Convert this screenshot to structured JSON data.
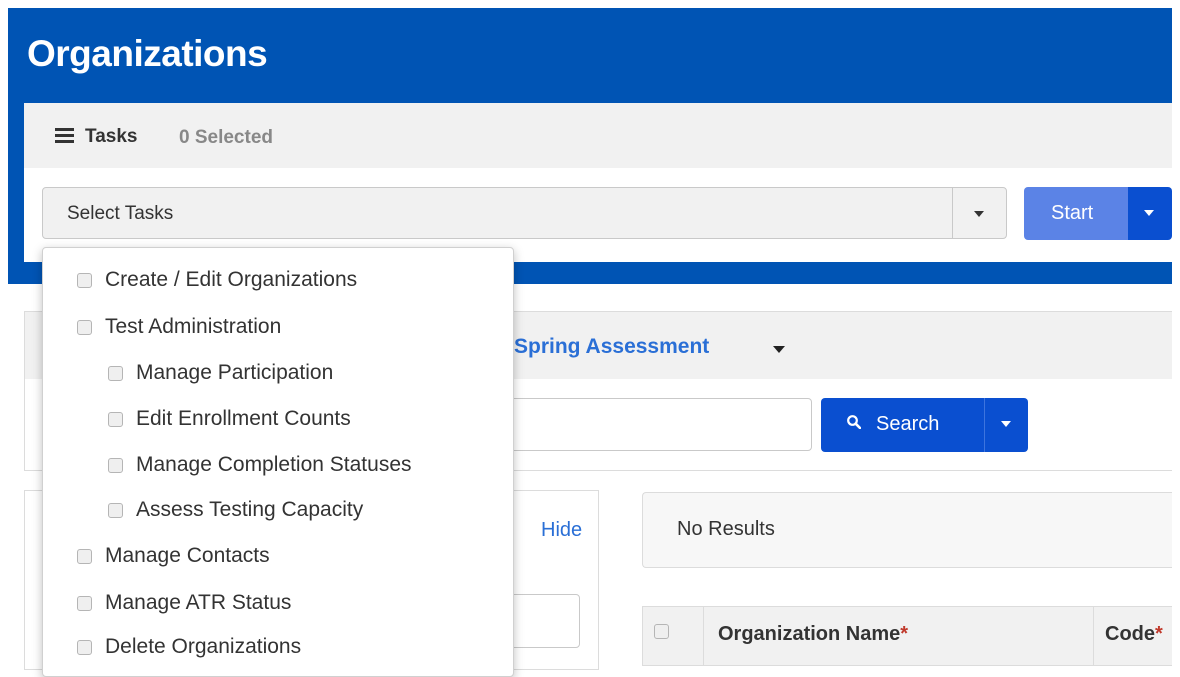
{
  "header": {
    "title": "Organizations"
  },
  "tasks": {
    "label": "Tasks",
    "selected_count": "0 Selected",
    "select_placeholder": "Select Tasks",
    "start_label": "Start"
  },
  "task_menu": {
    "items": [
      {
        "label": "Create / Edit Organizations",
        "checked": false
      },
      {
        "label": "Test Administration",
        "checked": false
      },
      {
        "label": "Manage Participation",
        "checked": false
      },
      {
        "label": "Edit Enrollment Counts",
        "checked": false
      },
      {
        "label": "Manage Completion Statuses",
        "checked": false
      },
      {
        "label": "Assess Testing Capacity",
        "checked": false
      },
      {
        "label": "Manage Contacts",
        "checked": false
      },
      {
        "label": "Manage ATR Status",
        "checked": false
      },
      {
        "label": "Delete Organizations",
        "checked": false
      }
    ]
  },
  "assessment": {
    "label": "Spring Assessment"
  },
  "search": {
    "button_label": "Search",
    "input_value": ""
  },
  "filters": {
    "hide_label": "Hide",
    "input_value": ""
  },
  "results": {
    "status": "No Results",
    "columns": [
      {
        "label": "Organization Name",
        "required_mark": "*"
      },
      {
        "label": "Code",
        "required_mark": "*"
      }
    ]
  },
  "colors": {
    "header_bg": "#0054b4",
    "primary_button": "#0a4fd0",
    "start_button": "#5b83e6",
    "link": "#2a6fd6",
    "required": "#c0392b"
  },
  "icons": {
    "tasks": "tasks-list-icon",
    "search": "magnifier-icon",
    "dropdown": "caret-down-icon"
  }
}
